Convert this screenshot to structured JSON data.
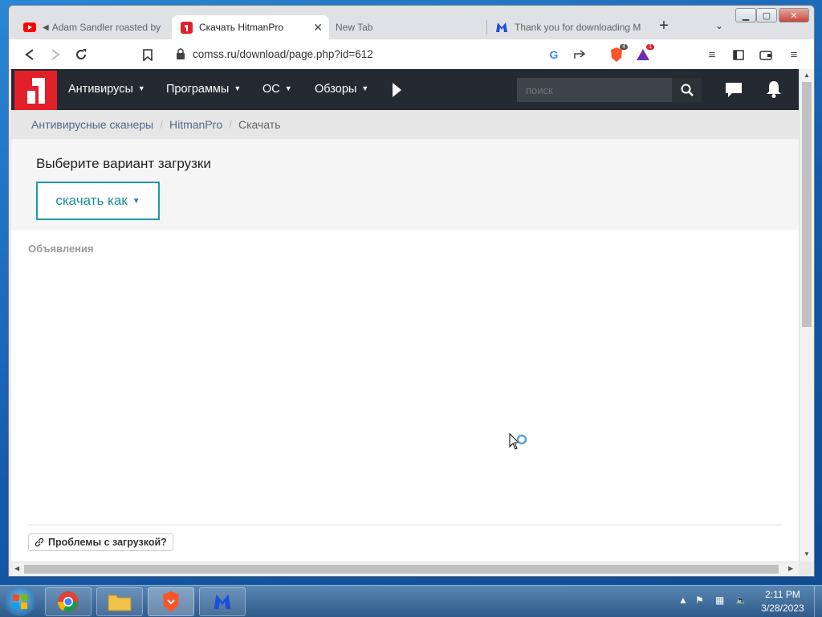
{
  "browser": {
    "tabs": [
      {
        "title": "Adam Sandler roasted by",
        "icon": "youtube-icon"
      },
      {
        "title": "Скачать HitmanPro",
        "icon": "comss-icon",
        "active": true
      },
      {
        "title": "New Tab",
        "icon": "none"
      },
      {
        "title": "Thank you for downloading M",
        "icon": "malwarebytes-icon"
      }
    ],
    "url": "comss.ru/download/page.php?id=612",
    "brave_badge": "4",
    "rewards_badge": "1"
  },
  "site": {
    "nav": [
      "Антивирусы",
      "Программы",
      "ОС",
      "Обзоры"
    ],
    "search_placeholder": "поиск"
  },
  "breadcrumbs": [
    "Антивирусные сканеры",
    "HitmanPro",
    "Скачать"
  ],
  "download": {
    "heading": "Выберите вариант загрузки",
    "button": "скачать как"
  },
  "ads_label": "Объявления",
  "problems_button": "Проблемы с загрузкой?",
  "taskbar": {
    "time": "2:11 PM",
    "date": "3/28/2023"
  },
  "colors": {
    "nav_bg": "#232a32",
    "logo_red": "#e3202a",
    "accent_teal": "#1a9aab"
  }
}
